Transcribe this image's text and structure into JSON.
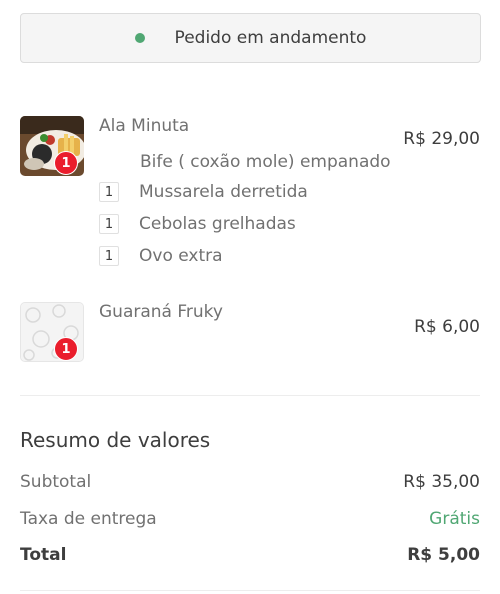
{
  "status": {
    "text": "Pedido em andamento",
    "dot_color": "#50a773"
  },
  "items": [
    {
      "name": "Ala Minuta",
      "price": "R$ 29,00",
      "quantity": "1",
      "image_icon": "food-plate-icon",
      "main_option": "Bife ( coxão mole) empanado",
      "extras": [
        {
          "qty": "1",
          "label": "Mussarela derretida"
        },
        {
          "qty": "1",
          "label": "Cebolas grelhadas"
        },
        {
          "qty": "1",
          "label": "Ovo extra"
        }
      ]
    },
    {
      "name": "Guaraná Fruky",
      "price": "R$ 6,00",
      "quantity": "1",
      "image_icon": "placeholder-pattern-icon"
    }
  ],
  "summary": {
    "title": "Resumo de valores",
    "subtotal_label": "Subtotal",
    "subtotal_value": "R$ 35,00",
    "delivery_label": "Taxa de entrega",
    "delivery_value": "Grátis",
    "total_label": "Total",
    "total_value": "R$ 5,00"
  },
  "colors": {
    "accent_red": "#ea1d2c",
    "free_green": "#50a773"
  }
}
